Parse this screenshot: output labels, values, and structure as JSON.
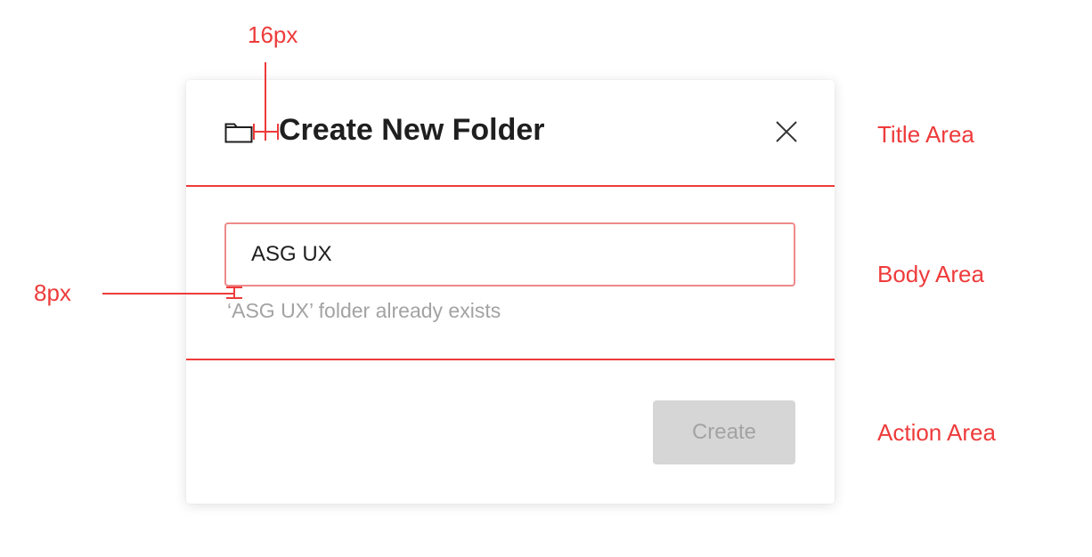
{
  "annotations": {
    "spacing_icon_title": "16px",
    "spacing_input_error": "8px",
    "title_area": "Title Area",
    "body_area": "Body Area",
    "action_area": "Action Area"
  },
  "dialog": {
    "title": "Create New Folder",
    "icon": "folder-icon",
    "close_icon": "close-icon",
    "input_value": "ASG UX",
    "error_message": "‘ASG UX’ folder already exists",
    "create_label": "Create"
  },
  "colors": {
    "annotation": "#ee3b3b",
    "disabled_button": "#d6d6d6",
    "disabled_text": "#a3a3a3"
  }
}
